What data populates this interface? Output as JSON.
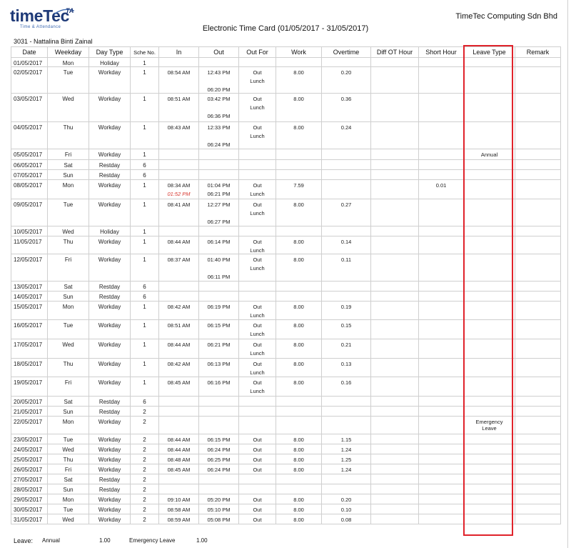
{
  "header": {
    "logo_text": "timeTec",
    "logo_suffix": "TA",
    "logo_tagline": "Time & Attendance",
    "company": "TimeTec Computing Sdn Bhd",
    "title": "Electronic Time Card  (01/05/2017 - 31/05/2017)",
    "employee": "3031 - Nattalina Binti Zainal"
  },
  "columns": [
    "Date",
    "Weekday",
    "Day Type",
    "Sche No.",
    "In",
    "Out",
    "Out For",
    "Work",
    "Overtime",
    "Diff OT Hour",
    "Short Hour",
    "Leave Type",
    "Remark"
  ],
  "rows": [
    {
      "date": "01/05/2017",
      "weekday": "Mon",
      "daytype": "Holiday",
      "sche": "1",
      "in": [],
      "out": [],
      "outfor": [],
      "work": "",
      "ot": "",
      "diff": "",
      "short": "",
      "leave": "",
      "remark": "",
      "h": 12
    },
    {
      "date": "02/05/2017",
      "weekday": "Tue",
      "daytype": "Workday",
      "sche": "1",
      "in": [
        "08:54 AM"
      ],
      "out": [
        "12:43 PM",
        "",
        "06:20 PM"
      ],
      "outfor": [
        "Out",
        "Lunch"
      ],
      "work": "8.00",
      "ot": "0.20",
      "diff": "",
      "short": "",
      "leave": "",
      "remark": "",
      "h": 37
    },
    {
      "date": "03/05/2017",
      "weekday": "Wed",
      "daytype": "Workday",
      "sche": "1",
      "in": [
        "08:51 AM"
      ],
      "out": [
        "03:42 PM",
        "",
        "06:36 PM"
      ],
      "outfor": [
        "Out",
        "Lunch"
      ],
      "work": "8.00",
      "ot": "0.36",
      "diff": "",
      "short": "",
      "leave": "",
      "remark": "",
      "h": 40
    },
    {
      "date": "04/05/2017",
      "weekday": "Thu",
      "daytype": "Workday",
      "sche": "1",
      "in": [
        "08:43 AM"
      ],
      "out": [
        "12:33 PM",
        "",
        "06:24 PM"
      ],
      "outfor": [
        "Out",
        "Lunch"
      ],
      "work": "8.00",
      "ot": "0.24",
      "diff": "",
      "short": "",
      "leave": "",
      "remark": "",
      "h": 38
    },
    {
      "date": "05/05/2017",
      "weekday": "Fri",
      "daytype": "Workday",
      "sche": "1",
      "in": [],
      "out": [],
      "outfor": [],
      "work": "",
      "ot": "",
      "diff": "",
      "short": "",
      "leave": "Annual",
      "remark": "",
      "h": 15
    },
    {
      "date": "06/05/2017",
      "weekday": "Sat",
      "daytype": "Restday",
      "sche": "6",
      "in": [],
      "out": [],
      "outfor": [],
      "work": "",
      "ot": "",
      "diff": "",
      "short": "",
      "leave": "",
      "remark": "",
      "h": 14
    },
    {
      "date": "07/05/2017",
      "weekday": "Sun",
      "daytype": "Restday",
      "sche": "6",
      "in": [],
      "out": [],
      "outfor": [],
      "work": "",
      "ot": "",
      "diff": "",
      "short": "",
      "leave": "",
      "remark": "",
      "h": 14
    },
    {
      "date": "08/05/2017",
      "weekday": "Mon",
      "daytype": "Workday",
      "sche": "1",
      "in": [
        "08:34 AM",
        "01:52 PM"
      ],
      "out": [
        "01:04 PM",
        "06:21 PM"
      ],
      "outfor": [
        "Out",
        "Lunch"
      ],
      "work": "7.59",
      "ot": "",
      "diff": "",
      "short": "0.01",
      "leave": "",
      "remark": "",
      "h": 27
    },
    {
      "date": "09/05/2017",
      "weekday": "Tue",
      "daytype": "Workday",
      "sche": "1",
      "in": [
        "08:41 AM"
      ],
      "out": [
        "12:27 PM",
        "",
        "06:27 PM"
      ],
      "outfor": [
        "Out",
        "Lunch"
      ],
      "work": "8.00",
      "ot": "0.27",
      "diff": "",
      "short": "",
      "leave": "",
      "remark": "",
      "h": 38
    },
    {
      "date": "10/05/2017",
      "weekday": "Wed",
      "daytype": "Holiday",
      "sche": "1",
      "in": [],
      "out": [],
      "outfor": [],
      "work": "",
      "ot": "",
      "diff": "",
      "short": "",
      "leave": "",
      "remark": "",
      "h": 14
    },
    {
      "date": "11/05/2017",
      "weekday": "Thu",
      "daytype": "Workday",
      "sche": "1",
      "in": [
        "08:44 AM"
      ],
      "out": [
        "06:14 PM"
      ],
      "outfor": [
        "Out",
        "Lunch"
      ],
      "work": "8.00",
      "ot": "0.14",
      "diff": "",
      "short": "",
      "leave": "",
      "remark": "",
      "h": 25
    },
    {
      "date": "12/05/2017",
      "weekday": "Fri",
      "daytype": "Workday",
      "sche": "1",
      "in": [
        "08:37 AM"
      ],
      "out": [
        "01:40 PM",
        "",
        "06:11 PM"
      ],
      "outfor": [
        "Out",
        "Lunch"
      ],
      "work": "8.00",
      "ot": "0.11",
      "diff": "",
      "short": "",
      "leave": "",
      "remark": "",
      "h": 38
    },
    {
      "date": "13/05/2017",
      "weekday": "Sat",
      "daytype": "Restday",
      "sche": "6",
      "in": [],
      "out": [],
      "outfor": [],
      "work": "",
      "ot": "",
      "diff": "",
      "short": "",
      "leave": "",
      "remark": "",
      "h": 14
    },
    {
      "date": "14/05/2017",
      "weekday": "Sun",
      "daytype": "Restday",
      "sche": "6",
      "in": [],
      "out": [],
      "outfor": [],
      "work": "",
      "ot": "",
      "diff": "",
      "short": "",
      "leave": "",
      "remark": "",
      "h": 14
    },
    {
      "date": "15/05/2017",
      "weekday": "Mon",
      "daytype": "Workday",
      "sche": "1",
      "in": [
        "08:42 AM"
      ],
      "out": [
        "06:19 PM"
      ],
      "outfor": [
        "Out",
        "Lunch"
      ],
      "work": "8.00",
      "ot": "0.19",
      "diff": "",
      "short": "",
      "leave": "",
      "remark": "",
      "h": 26
    },
    {
      "date": "16/05/2017",
      "weekday": "Tue",
      "daytype": "Workday",
      "sche": "1",
      "in": [
        "08:51 AM"
      ],
      "out": [
        "06:15 PM"
      ],
      "outfor": [
        "Out",
        "Lunch"
      ],
      "work": "8.00",
      "ot": "0.15",
      "diff": "",
      "short": "",
      "leave": "",
      "remark": "",
      "h": 27
    },
    {
      "date": "17/05/2017",
      "weekday": "Wed",
      "daytype": "Workday",
      "sche": "1",
      "in": [
        "08:44 AM"
      ],
      "out": [
        "06:21 PM"
      ],
      "outfor": [
        "Out",
        "Lunch"
      ],
      "work": "8.00",
      "ot": "0.21",
      "diff": "",
      "short": "",
      "leave": "",
      "remark": "",
      "h": 27
    },
    {
      "date": "18/05/2017",
      "weekday": "Thu",
      "daytype": "Workday",
      "sche": "1",
      "in": [
        "08:42 AM"
      ],
      "out": [
        "06:13 PM"
      ],
      "outfor": [
        "Out",
        "Lunch"
      ],
      "work": "8.00",
      "ot": "0.13",
      "diff": "",
      "short": "",
      "leave": "",
      "remark": "",
      "h": 26
    },
    {
      "date": "19/05/2017",
      "weekday": "Fri",
      "daytype": "Workday",
      "sche": "1",
      "in": [
        "08:45 AM"
      ],
      "out": [
        "06:16 PM"
      ],
      "outfor": [
        "Out",
        "Lunch"
      ],
      "work": "8.00",
      "ot": "0.16",
      "diff": "",
      "short": "",
      "leave": "",
      "remark": "",
      "h": 27
    },
    {
      "date": "20/05/2017",
      "weekday": "Sat",
      "daytype": "Restday",
      "sche": "6",
      "in": [],
      "out": [],
      "outfor": [],
      "work": "",
      "ot": "",
      "diff": "",
      "short": "",
      "leave": "",
      "remark": "",
      "h": 14
    },
    {
      "date": "21/05/2017",
      "weekday": "Sun",
      "daytype": "Restday",
      "sche": "2",
      "in": [],
      "out": [],
      "outfor": [],
      "work": "",
      "ot": "",
      "diff": "",
      "short": "",
      "leave": "",
      "remark": "",
      "h": 14
    },
    {
      "date": "22/05/2017",
      "weekday": "Mon",
      "daytype": "Workday",
      "sche": "2",
      "in": [],
      "out": [],
      "outfor": [],
      "work": "",
      "ot": "",
      "diff": "",
      "short": "",
      "leave": "Emergency Leave",
      "remark": "",
      "h": 25
    },
    {
      "date": "23/05/2017",
      "weekday": "Tue",
      "daytype": "Workday",
      "sche": "2",
      "in": [
        "08:44 AM"
      ],
      "out": [
        "06:15 PM"
      ],
      "outfor": [
        "Out"
      ],
      "work": "8.00",
      "ot": "1.15",
      "diff": "",
      "short": "",
      "leave": "",
      "remark": "",
      "h": 14
    },
    {
      "date": "24/05/2017",
      "weekday": "Wed",
      "daytype": "Workday",
      "sche": "2",
      "in": [
        "08:44 AM"
      ],
      "out": [
        "06:24 PM"
      ],
      "outfor": [
        "Out"
      ],
      "work": "8.00",
      "ot": "1.24",
      "diff": "",
      "short": "",
      "leave": "",
      "remark": "",
      "h": 14
    },
    {
      "date": "25/05/2017",
      "weekday": "Thu",
      "daytype": "Workday",
      "sche": "2",
      "in": [
        "08:48 AM"
      ],
      "out": [
        "06:25 PM"
      ],
      "outfor": [
        "Out"
      ],
      "work": "8.00",
      "ot": "1.25",
      "diff": "",
      "short": "",
      "leave": "",
      "remark": "",
      "h": 14
    },
    {
      "date": "26/05/2017",
      "weekday": "Fri",
      "daytype": "Workday",
      "sche": "2",
      "in": [
        "08:45 AM"
      ],
      "out": [
        "06:24 PM"
      ],
      "outfor": [
        "Out"
      ],
      "work": "8.00",
      "ot": "1.24",
      "diff": "",
      "short": "",
      "leave": "",
      "remark": "",
      "h": 14
    },
    {
      "date": "27/05/2017",
      "weekday": "Sat",
      "daytype": "Restday",
      "sche": "2",
      "in": [],
      "out": [],
      "outfor": [],
      "work": "",
      "ot": "",
      "diff": "",
      "short": "",
      "leave": "",
      "remark": "",
      "h": 14
    },
    {
      "date": "28/05/2017",
      "weekday": "Sun",
      "daytype": "Restday",
      "sche": "2",
      "in": [],
      "out": [],
      "outfor": [],
      "work": "",
      "ot": "",
      "diff": "",
      "short": "",
      "leave": "",
      "remark": "",
      "h": 14
    },
    {
      "date": "29/05/2017",
      "weekday": "Mon",
      "daytype": "Workday",
      "sche": "2",
      "in": [
        "09:10 AM"
      ],
      "out": [
        "05:20 PM"
      ],
      "outfor": [
        "Out"
      ],
      "work": "8.00",
      "ot": "0.20",
      "diff": "",
      "short": "",
      "leave": "",
      "remark": "",
      "h": 14
    },
    {
      "date": "30/05/2017",
      "weekday": "Tue",
      "daytype": "Workday",
      "sche": "2",
      "in": [
        "08:58 AM"
      ],
      "out": [
        "05:10 PM"
      ],
      "outfor": [
        "Out"
      ],
      "work": "8.00",
      "ot": "0.10",
      "diff": "",
      "short": "",
      "leave": "",
      "remark": "",
      "h": 14
    },
    {
      "date": "31/05/2017",
      "weekday": "Wed",
      "daytype": "Workday",
      "sche": "2",
      "in": [
        "08:59 AM"
      ],
      "out": [
        "05:08 PM"
      ],
      "outfor": [
        "Out"
      ],
      "work": "8.00",
      "ot": "0.08",
      "diff": "",
      "short": "",
      "leave": "",
      "remark": "",
      "h": 14
    }
  ],
  "leave_summary": {
    "label": "Leave:",
    "items": [
      {
        "type": "Annual",
        "value": "1.00"
      },
      {
        "type": "Emergency Leave",
        "value": "1.00"
      }
    ]
  },
  "colors": {
    "highlight": "#e0232b",
    "late_time": "#d83a32",
    "logo": "#1f3a78"
  }
}
